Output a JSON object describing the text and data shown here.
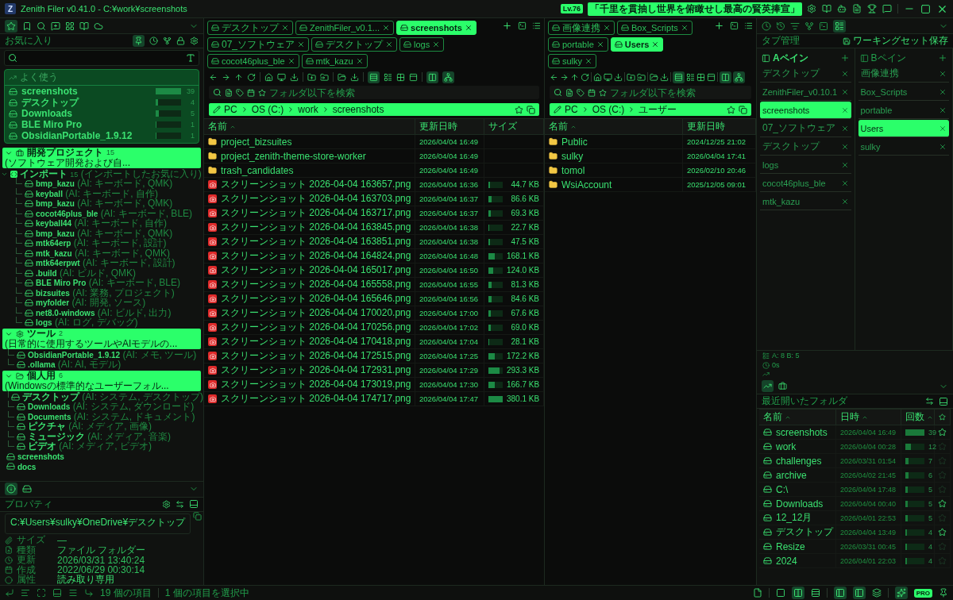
{
  "window": {
    "logo_letter": "Z",
    "title": "Zenith Filer v0.41.0 - C:¥work¥screenshots",
    "level_badge": "Lv.76",
    "motto": "「千里を貫抽し世界を俯瞰せし最高の賢英捧宣」"
  },
  "sidebar": {
    "section_title": "お気に入り",
    "frequent": {
      "title": "よく使う",
      "items": [
        {
          "name": "screenshots",
          "count": "39",
          "level": 1
        },
        {
          "name": "デスクトップ",
          "count": "4",
          "level": 0.1
        },
        {
          "name": "Downloads",
          "count": "5",
          "level": 0.13
        },
        {
          "name": "BLE Miro Pro",
          "count": "1",
          "level": 0.03
        },
        {
          "name": "ObsidianPortable_1.9.12",
          "count": "1",
          "level": 0.03
        }
      ]
    },
    "tree": [
      {
        "kind": "group",
        "label": "開発プロジェクト",
        "count": "15",
        "note": "(ソフトウェア開発および自...",
        "expanded": true,
        "children": [
          {
            "kind": "subgroup",
            "label": "インポート",
            "count": "15",
            "note": "(インポートしたお気に入り)",
            "expanded": true,
            "children": [
              {
                "kind": "folder",
                "label": "bmp_kazu",
                "note": "(AI: キーボード, QMK)"
              },
              {
                "kind": "folder",
                "label": "keyball",
                "note": "(AI: キーボード, 自作)"
              },
              {
                "kind": "folder",
                "label": "bmp_kazu",
                "note": "(AI: キーボード, QMK)"
              },
              {
                "kind": "folder",
                "label": "cocot46plus_ble",
                "note": "(AI: キーボード, BLE)"
              },
              {
                "kind": "folder",
                "label": "keyball44",
                "note": "(AI: キーボード, 自作)"
              },
              {
                "kind": "folder",
                "label": "bmp_kazu",
                "note": "(AI: キーボード, QMK)"
              },
              {
                "kind": "folder",
                "label": "mtk64erp",
                "note": "(AI: キーボード, 設計)"
              },
              {
                "kind": "folder",
                "label": "mtk_kazu",
                "note": "(AI: キーボード, QMK)"
              },
              {
                "kind": "folder",
                "label": "mtk64erpwt",
                "note": "(AI: キーボード, 設計)"
              },
              {
                "kind": "folder",
                "label": ".build",
                "note": "(AI: ビルド, QMK)"
              },
              {
                "kind": "folder",
                "label": "BLE Miro Pro",
                "note": "(AI: キーボード, BLE)"
              },
              {
                "kind": "folder",
                "label": "bizsuites",
                "note": "(AI: 業務, プロジェクト)"
              },
              {
                "kind": "folder",
                "label": "myfolder",
                "note": "(AI: 開発, ソース)"
              },
              {
                "kind": "folder",
                "label": "net8.0-windows",
                "note": "(AI: ビルド, 出力)"
              },
              {
                "kind": "folder",
                "label": "logs",
                "note": "(AI: ログ, デバッグ)"
              }
            ]
          }
        ]
      },
      {
        "kind": "group",
        "label": "ツール",
        "count": "2",
        "note": "(日常的に使用するツールやAIモデルの...",
        "expanded": true,
        "children": [
          {
            "kind": "folder",
            "label": "ObsidianPortable_1.9.12",
            "note": "(AI: メモ, ツール)"
          },
          {
            "kind": "folder",
            "label": ".ollama",
            "note": "(AI: AI, モデル)"
          }
        ]
      },
      {
        "kind": "group",
        "label": "個人用",
        "count": "6",
        "note": "(Windowsの標準的なユーザーフォル...",
        "expanded": true,
        "children": [
          {
            "kind": "folder",
            "label": "デスクトップ",
            "note": "(AI: システム, デスクトップ)"
          },
          {
            "kind": "folder",
            "label": "Downloads",
            "note": "(AI: システム, ダウンロード)"
          },
          {
            "kind": "folder",
            "label": "Documents",
            "note": "(AI: システム, ドキュメント)"
          },
          {
            "kind": "folder",
            "label": "ピクチャ",
            "note": "(AI: メディア, 画像)"
          },
          {
            "kind": "folder",
            "label": "ミュージック",
            "note": "(AI: メディア, 音楽)"
          },
          {
            "kind": "folder",
            "label": "ビデオ",
            "note": "(AI: メディア, ビデオ)"
          }
        ]
      },
      {
        "kind": "folder",
        "label": "screenshots"
      },
      {
        "kind": "folder",
        "label": "docs"
      }
    ],
    "properties": {
      "title": "プロパティ",
      "path": "C:¥Users¥sulky¥OneDrive¥デスクトップ",
      "rows": [
        {
          "kind": "size",
          "label": "サイズ",
          "value": "—"
        },
        {
          "kind": "type",
          "label": "種類",
          "value": "ファイル フォルダー"
        },
        {
          "kind": "modified",
          "label": "更新",
          "value": "2026/03/31 13:40:24"
        },
        {
          "kind": "created",
          "label": "作成",
          "value": "2022/06/29 00:30:14"
        },
        {
          "kind": "attributes",
          "label": "属性",
          "value": "読み取り専用"
        }
      ]
    }
  },
  "panes": [
    {
      "tabs": [
        {
          "label": "デスクトップ",
          "selected": false
        },
        {
          "label": "ZenithFiler_v0.1...",
          "selected": false
        },
        {
          "label": "screenshots",
          "selected": true
        },
        {
          "label": "07_ソフトウェア",
          "selected": false
        },
        {
          "label": "デスクトップ",
          "selected": false
        },
        {
          "label": "logs",
          "selected": false
        },
        {
          "label": "cocot46plus_ble",
          "selected": false
        },
        {
          "label": "mtk_kazu",
          "selected": false
        }
      ],
      "search_placeholder": "フォルダ以下を検索",
      "breadcrumb": [
        "PC",
        "OS (C:)",
        "work",
        "screenshots"
      ],
      "columns": [
        {
          "label": "名前",
          "sorted": true
        },
        {
          "label": "更新日時",
          "sorted": false
        },
        {
          "label": "サイズ",
          "sorted": false
        }
      ],
      "rows": [
        {
          "kind": "folder",
          "name": "project_bizsuites",
          "modified": "2026/04/04 16:49"
        },
        {
          "kind": "folder",
          "name": "project_zenith-theme-store-worker",
          "modified": "2026/04/04 16:49"
        },
        {
          "kind": "folder",
          "name": "trash_candidates",
          "modified": "2026/04/04 16:49"
        },
        {
          "kind": "image",
          "name": "スクリーンショット 2026-04-04 163657.png",
          "modified": "2026/04/04 16:36",
          "size": "44.7 KB",
          "level": 0.12
        },
        {
          "kind": "image",
          "name": "スクリーンショット 2026-04-04 163703.png",
          "modified": "2026/04/04 16:37",
          "size": "86.6 KB",
          "level": 0.23
        },
        {
          "kind": "image",
          "name": "スクリーンショット 2026-04-04 163717.png",
          "modified": "2026/04/04 16:37",
          "size": "69.3 KB",
          "level": 0.18
        },
        {
          "kind": "image",
          "name": "スクリーンショット 2026-04-04 163845.png",
          "modified": "2026/04/04 16:38",
          "size": "22.7 KB",
          "level": 0.06
        },
        {
          "kind": "image",
          "name": "スクリーンショット 2026-04-04 163851.png",
          "modified": "2026/04/04 16:38",
          "size": "47.5 KB",
          "level": 0.12
        },
        {
          "kind": "image",
          "name": "スクリーンショット 2026-04-04 164824.png",
          "modified": "2026/04/04 16:48",
          "size": "168.1 KB",
          "level": 0.44
        },
        {
          "kind": "image",
          "name": "スクリーンショット 2026-04-04 165017.png",
          "modified": "2026/04/04 16:50",
          "size": "124.0 KB",
          "level": 0.33
        },
        {
          "kind": "image",
          "name": "スクリーンショット 2026-04-04 165558.png",
          "modified": "2026/04/04 16:55",
          "size": "81.3 KB",
          "level": 0.21
        },
        {
          "kind": "image",
          "name": "スクリーンショット 2026-04-04 165646.png",
          "modified": "2026/04/04 16:56",
          "size": "84.6 KB",
          "level": 0.22
        },
        {
          "kind": "image",
          "name": "スクリーンショット 2026-04-04 170020.png",
          "modified": "2026/04/04 17:00",
          "size": "67.6 KB",
          "level": 0.18
        },
        {
          "kind": "image",
          "name": "スクリーンショット 2026-04-04 170256.png",
          "modified": "2026/04/04 17:02",
          "size": "69.0 KB",
          "level": 0.18
        },
        {
          "kind": "image",
          "name": "スクリーンショット 2026-04-04 170418.png",
          "modified": "2026/04/04 17:04",
          "size": "28.1 KB",
          "level": 0.07
        },
        {
          "kind": "image",
          "name": "スクリーンショット 2026-04-04 172515.png",
          "modified": "2026/04/04 17:25",
          "size": "172.2 KB",
          "level": 0.45
        },
        {
          "kind": "image",
          "name": "スクリーンショット 2026-04-04 172931.png",
          "modified": "2026/04/04 17:29",
          "size": "293.3 KB",
          "level": 0.77
        },
        {
          "kind": "image",
          "name": "スクリーンショット 2026-04-04 173019.png",
          "modified": "2026/04/04 17:30",
          "size": "166.7 KB",
          "level": 0.44
        },
        {
          "kind": "image",
          "name": "スクリーンショット 2026-04-04 174717.png",
          "modified": "2026/04/04 17:47",
          "size": "380.1 KB",
          "level": 1
        }
      ]
    },
    {
      "tabs": [
        {
          "label": "画像連携",
          "selected": false
        },
        {
          "label": "Box_Scripts",
          "selected": false
        },
        {
          "label": "portable",
          "selected": false
        },
        {
          "label": "Users",
          "selected": true
        },
        {
          "label": "sulky",
          "selected": false
        }
      ],
      "search_placeholder": "フォルダ以下を検索",
      "breadcrumb": [
        "PC",
        "OS (C:)",
        "ユーザー"
      ],
      "columns": [
        {
          "label": "名前",
          "sorted": true
        },
        {
          "label": "更新日時",
          "sorted": false
        }
      ],
      "rows": [
        {
          "kind": "folder",
          "name": "Public",
          "modified": "2024/12/25 21:02"
        },
        {
          "kind": "folder",
          "name": "sulky",
          "modified": "2026/04/04 17:41"
        },
        {
          "kind": "folder",
          "name": "tomol",
          "modified": "2026/02/10 20:46"
        },
        {
          "kind": "folder",
          "name": "WsiAccount",
          "modified": "2025/12/05 09:01"
        }
      ]
    }
  ],
  "right_panel": {
    "title": "タブ管理",
    "save_label": "ワーキングセット保存",
    "pane_lists": [
      {
        "label": "Aペイン",
        "active": true,
        "tabs": [
          {
            "label": "デスクトップ",
            "selected": false
          },
          {
            "label": "ZenithFiler_v0.10.1",
            "selected": false
          },
          {
            "label": "screenshots",
            "selected": true
          },
          {
            "label": "07_ソフトウェア",
            "selected": false
          },
          {
            "label": "デスクトップ",
            "selected": false
          },
          {
            "label": "logs",
            "selected": false
          },
          {
            "label": "cocot46plus_ble",
            "selected": false
          },
          {
            "label": "mtk_kazu",
            "selected": false
          }
        ]
      },
      {
        "label": "Bペイン",
        "active": false,
        "tabs": [
          {
            "label": "画像連携",
            "selected": false
          },
          {
            "label": "Box_Scripts",
            "selected": false
          },
          {
            "label": "portable",
            "selected": false
          },
          {
            "label": "Users",
            "selected": true
          },
          {
            "label": "sulky",
            "selected": false
          }
        ]
      }
    ],
    "tab_counts": "A: 8  B: 5",
    "elapsed": "0s",
    "recent": {
      "title": "最近開いたフォルダ",
      "columns": [
        {
          "label": "名前",
          "sorted": true
        },
        {
          "label": "日時",
          "sorted": true
        },
        {
          "label": "回数",
          "sorted": true
        }
      ],
      "rows": [
        {
          "name": "screenshots",
          "date": "2026/04/04 16:49",
          "count": "39",
          "level": 1,
          "starred": true
        },
        {
          "name": "work",
          "date": "2026/04/04 00:28",
          "count": "12",
          "level": 0.31,
          "starred": false
        },
        {
          "name": "challenges",
          "date": "2026/03/31 01:54",
          "count": "7",
          "level": 0.18,
          "starred": false
        },
        {
          "name": "archive",
          "date": "2026/04/02 21:45",
          "count": "6",
          "level": 0.15,
          "starred": false
        },
        {
          "name": "C:\\",
          "date": "2026/04/04 17:48",
          "count": "5",
          "level": 0.13,
          "starred": false
        },
        {
          "name": "Downloads",
          "date": "2026/04/04 00:40",
          "count": "5",
          "level": 0.13,
          "starred": true
        },
        {
          "name": "12_12月",
          "date": "2026/04/01 22:53",
          "count": "5",
          "level": 0.13,
          "starred": false
        },
        {
          "name": "デスクトップ",
          "date": "2026/04/04 13:49",
          "count": "4",
          "level": 0.1,
          "starred": true
        },
        {
          "name": "Resize",
          "date": "2026/03/31 00:45",
          "count": "4",
          "level": 0.1,
          "starred": false
        },
        {
          "name": "2024",
          "date": "2026/04/01 22:03",
          "count": "4",
          "level": 0.1,
          "starred": false
        }
      ]
    }
  },
  "status_bar": {
    "item_count": "19 個の項目",
    "selection": "1 個の項目を選択中",
    "pro_badge": "PRO"
  }
}
